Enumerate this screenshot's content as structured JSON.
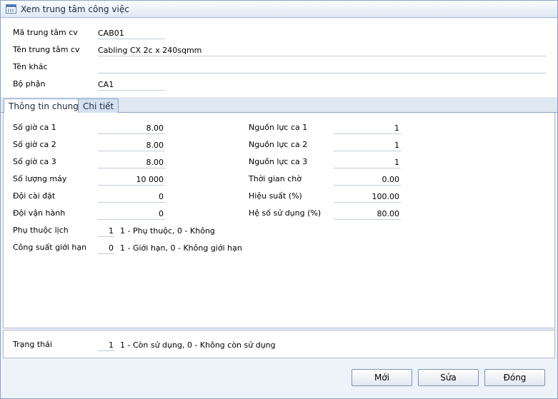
{
  "window": {
    "title": "Xem trung tâm công việc",
    "icon": "table-window-icon"
  },
  "header": {
    "code_label": "Mã trung tâm cv",
    "code_value": "CAB01",
    "name_label": "Tên trung tâm cv",
    "name_value": "Cabling CX 2c x 240sqmm",
    "other_name_label": "Tên khác",
    "other_name_value": "",
    "department_label": "Bộ phận",
    "department_value": "CA1"
  },
  "tabs": [
    {
      "label": "Thông tin chung",
      "active": true
    },
    {
      "label": "Chi tiết",
      "active": false
    }
  ],
  "general": {
    "left": [
      {
        "label": "Số giờ ca 1",
        "value": "8.00"
      },
      {
        "label": "Số giờ ca 2",
        "value": "8.00"
      },
      {
        "label": "Số giờ ca 3",
        "value": "8.00"
      },
      {
        "label": "Số lượng máy",
        "value": "10 000"
      },
      {
        "label": "Đội cài đặt",
        "value": "0"
      },
      {
        "label": "Đội vận hành",
        "value": "0"
      }
    ],
    "right": [
      {
        "label": "Nguồn lực ca 1",
        "value": "1"
      },
      {
        "label": "Nguồn lực ca 2",
        "value": "1"
      },
      {
        "label": "Nguồn lực ca 3",
        "value": "1"
      },
      {
        "label": "Thời gian chờ",
        "value": "0.00"
      },
      {
        "label": "Hiệu suất (%)",
        "value": "100.00"
      },
      {
        "label": "Hệ số sử dụng (%)",
        "value": "80.00"
      }
    ],
    "calendar_label": "Phụ thuộc lịch",
    "calendar_value": "1",
    "calendar_hint": "1 - Phụ thuộc, 0 - Không",
    "capacity_label": "Công suất giới hạn",
    "capacity_value": "0",
    "capacity_hint": "1 - Giới hạn, 0 - Không giới hạn"
  },
  "status": {
    "label": "Trạng thái",
    "value": "1",
    "hint": "1 - Còn sử dụng, 0 - Không còn sử dụng"
  },
  "buttons": {
    "new": "Mới",
    "edit": "Sửa",
    "close": "Đóng"
  }
}
